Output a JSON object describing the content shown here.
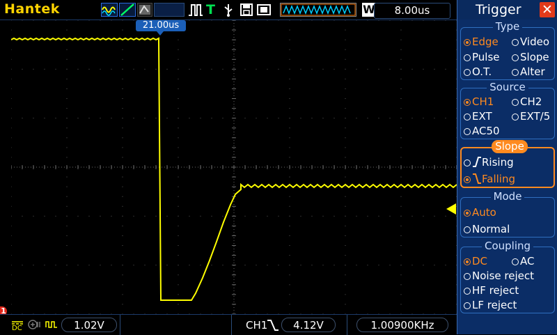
{
  "topbar": {
    "brand": "Hantek",
    "trigger_position": "21.00us",
    "trigger_time": "8.00us",
    "timebase_mode": "W",
    "run_state_icon": "t-icon"
  },
  "trigger_panel": {
    "title": "Trigger",
    "type": {
      "title": "Type",
      "options": [
        {
          "label": "Edge",
          "selected": true
        },
        {
          "label": "Video",
          "selected": false
        },
        {
          "label": "Pulse",
          "selected": false
        },
        {
          "label": "Slope",
          "selected": false
        },
        {
          "label": "O.T.",
          "selected": false
        },
        {
          "label": "Alter",
          "selected": false
        }
      ]
    },
    "source": {
      "title": "Source",
      "options": [
        {
          "label": "CH1",
          "selected": true
        },
        {
          "label": "CH2",
          "selected": false
        },
        {
          "label": "EXT",
          "selected": false
        },
        {
          "label": "EXT/5",
          "selected": false
        },
        {
          "label": "AC50",
          "selected": false
        }
      ]
    },
    "slope": {
      "title": "Slope",
      "options": [
        {
          "label": "Rising",
          "selected": false
        },
        {
          "label": "Falling",
          "selected": true
        }
      ]
    },
    "mode": {
      "title": "Mode",
      "options": [
        {
          "label": "Auto",
          "selected": true
        },
        {
          "label": "Normal",
          "selected": false
        }
      ]
    },
    "coupling": {
      "title": "Coupling",
      "options": [
        {
          "label": "DC",
          "selected": true
        },
        {
          "label": "AC",
          "selected": false
        },
        {
          "label": "Noise reject",
          "selected": false
        },
        {
          "label": "HF reject",
          "selected": false
        },
        {
          "label": "LF reject",
          "selected": false
        }
      ]
    }
  },
  "bottombar": {
    "ch1_scale": "1.02V",
    "trigger_channel": "CH1",
    "trigger_level": "4.12V",
    "frequency": "1.00900KHz"
  },
  "colors": {
    "trace": "#ffff00",
    "accent": "#ff8a1f",
    "panel": "#0b2d66",
    "brand": "#ffd400"
  }
}
